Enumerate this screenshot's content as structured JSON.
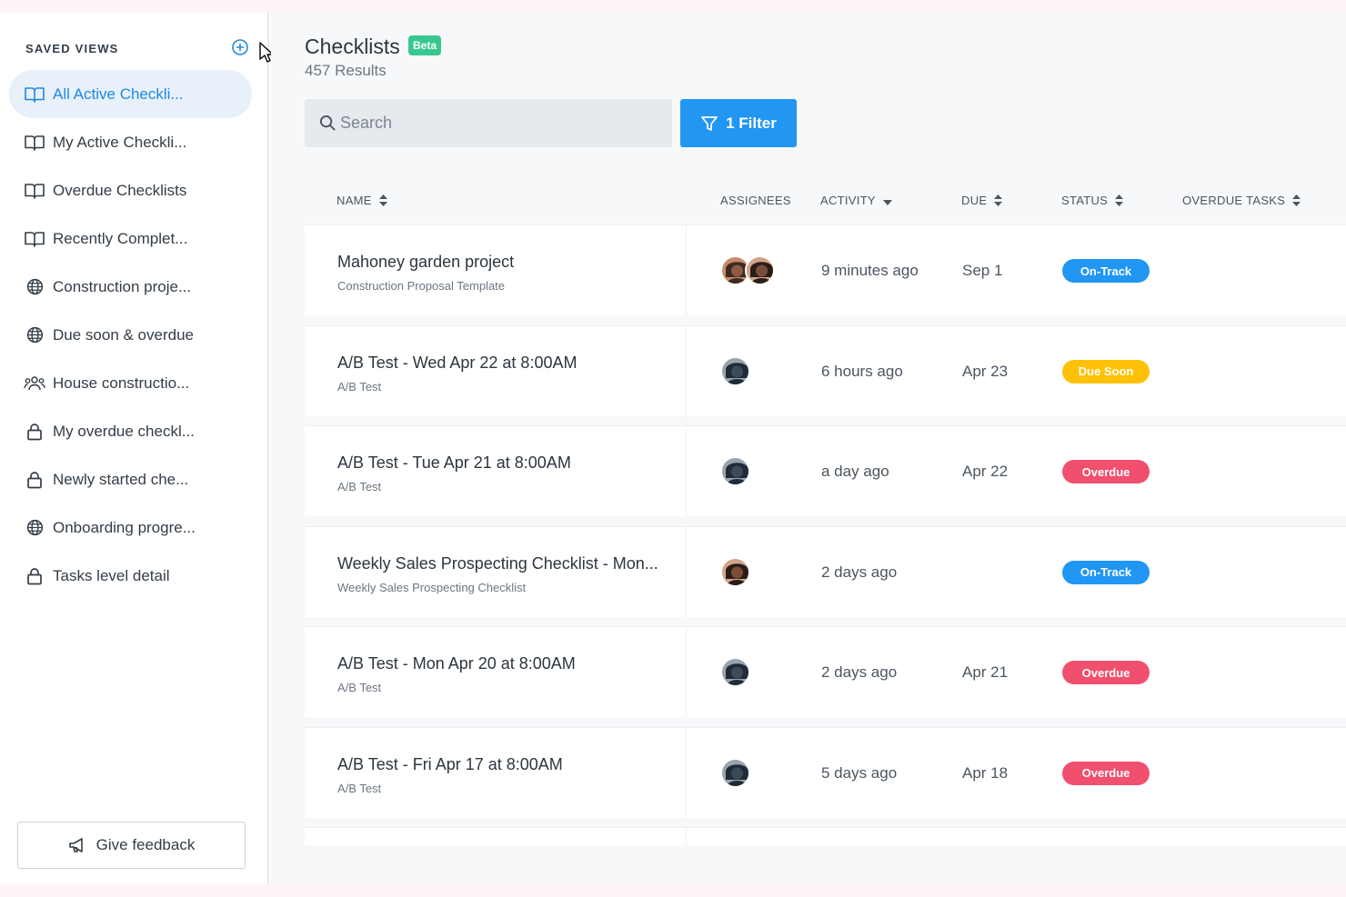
{
  "sidebar": {
    "heading": "SAVED VIEWS",
    "items": [
      {
        "label": "All Active Checkli...",
        "icon": "book-icon",
        "active": true
      },
      {
        "label": "My Active Checkli...",
        "icon": "book-icon",
        "active": false
      },
      {
        "label": "Overdue Checklists",
        "icon": "book-icon",
        "active": false
      },
      {
        "label": "Recently Complet...",
        "icon": "book-icon",
        "active": false
      },
      {
        "label": "Construction proje...",
        "icon": "globe-icon",
        "active": false
      },
      {
        "label": "Due soon & overdue",
        "icon": "globe-icon",
        "active": false
      },
      {
        "label": "House constructio...",
        "icon": "users-icon",
        "active": false
      },
      {
        "label": "My overdue checkl...",
        "icon": "lock-icon",
        "active": false
      },
      {
        "label": "Newly started che...",
        "icon": "lock-icon",
        "active": false
      },
      {
        "label": "Onboarding progre...",
        "icon": "globe-icon",
        "active": false
      },
      {
        "label": "Tasks level detail",
        "icon": "lock-icon",
        "active": false
      }
    ],
    "feedback_label": "Give feedback"
  },
  "header": {
    "title": "Checklists",
    "beta": "Beta",
    "results": "457 Results"
  },
  "search": {
    "placeholder": "Search"
  },
  "filter": {
    "label": "1 Filter"
  },
  "columns": {
    "name": "NAME",
    "assignees": "ASSIGNEES",
    "activity": "ACTIVITY",
    "due": "DUE",
    "status": "STATUS",
    "overdue_tasks": "OVERDUE TASKS"
  },
  "status_colors": {
    "On-Track": "#2196f3",
    "Due Soon": "#ffc107",
    "Overdue": "#f0506e"
  },
  "rows": [
    {
      "name": "Mahoney garden project",
      "template": "Construction Proposal Template",
      "assignees": 2,
      "activity": "9 minutes ago",
      "due": "Sep 1",
      "status": "On-Track"
    },
    {
      "name": "A/B Test - Wed Apr 22 at 8:00AM",
      "template": "A/B Test",
      "assignees": 1,
      "activity": "6 hours ago",
      "due": "Apr 23",
      "status": "Due Soon"
    },
    {
      "name": "A/B Test - Tue Apr 21 at 8:00AM",
      "template": "A/B Test",
      "assignees": 1,
      "activity": "a day ago",
      "due": "Apr 22",
      "status": "Overdue"
    },
    {
      "name": "Weekly Sales Prospecting Checklist - Mon...",
      "template": "Weekly Sales Prospecting Checklist",
      "assignees": 1,
      "activity": "2 days ago",
      "due": "",
      "status": "On-Track"
    },
    {
      "name": "A/B Test - Mon Apr 20 at 8:00AM",
      "template": "A/B Test",
      "assignees": 1,
      "activity": "2 days ago",
      "due": "Apr 21",
      "status": "Overdue"
    },
    {
      "name": "A/B Test - Fri Apr 17 at 8:00AM",
      "template": "A/B Test",
      "assignees": 1,
      "activity": "5 days ago",
      "due": "Apr 18",
      "status": "Overdue"
    }
  ]
}
